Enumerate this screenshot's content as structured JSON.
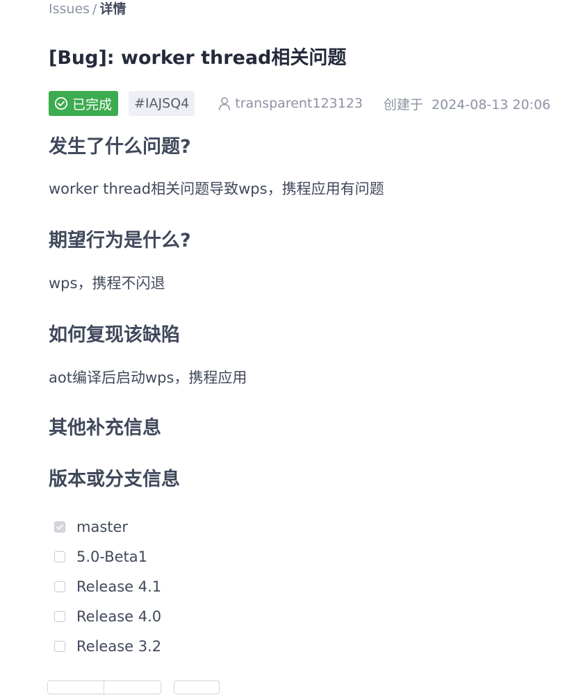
{
  "breadcrumb": {
    "parent": "Issues",
    "separator": "/",
    "current": "详情"
  },
  "issue": {
    "title": "[Bug]: worker thread相关问题",
    "status": "已完成",
    "status_color": "#3dab4f",
    "id": "#IAJSQ4",
    "author": "transparent123123",
    "created_label": "创建于",
    "created_at": "2024-08-13 20:06"
  },
  "sections": [
    {
      "heading": "发生了什么问题?",
      "body": "worker thread相关问题导致wps，携程应用有问题"
    },
    {
      "heading": "期望行为是什么?",
      "body": "wps，携程不闪退"
    },
    {
      "heading": "如何复现该缺陷",
      "body": "aot编译后启动wps，携程应用"
    },
    {
      "heading": "其他补充信息",
      "body": ""
    },
    {
      "heading": "版本或分支信息",
      "body": ""
    }
  ],
  "branches": [
    {
      "label": "master",
      "checked": true
    },
    {
      "label": "5.0-Beta1",
      "checked": false
    },
    {
      "label": "Release 4.1",
      "checked": false
    },
    {
      "label": "Release 4.0",
      "checked": false
    },
    {
      "label": "Release 3.2",
      "checked": false
    }
  ],
  "icons": {
    "status": "check-circle-icon",
    "author": "user-icon"
  }
}
